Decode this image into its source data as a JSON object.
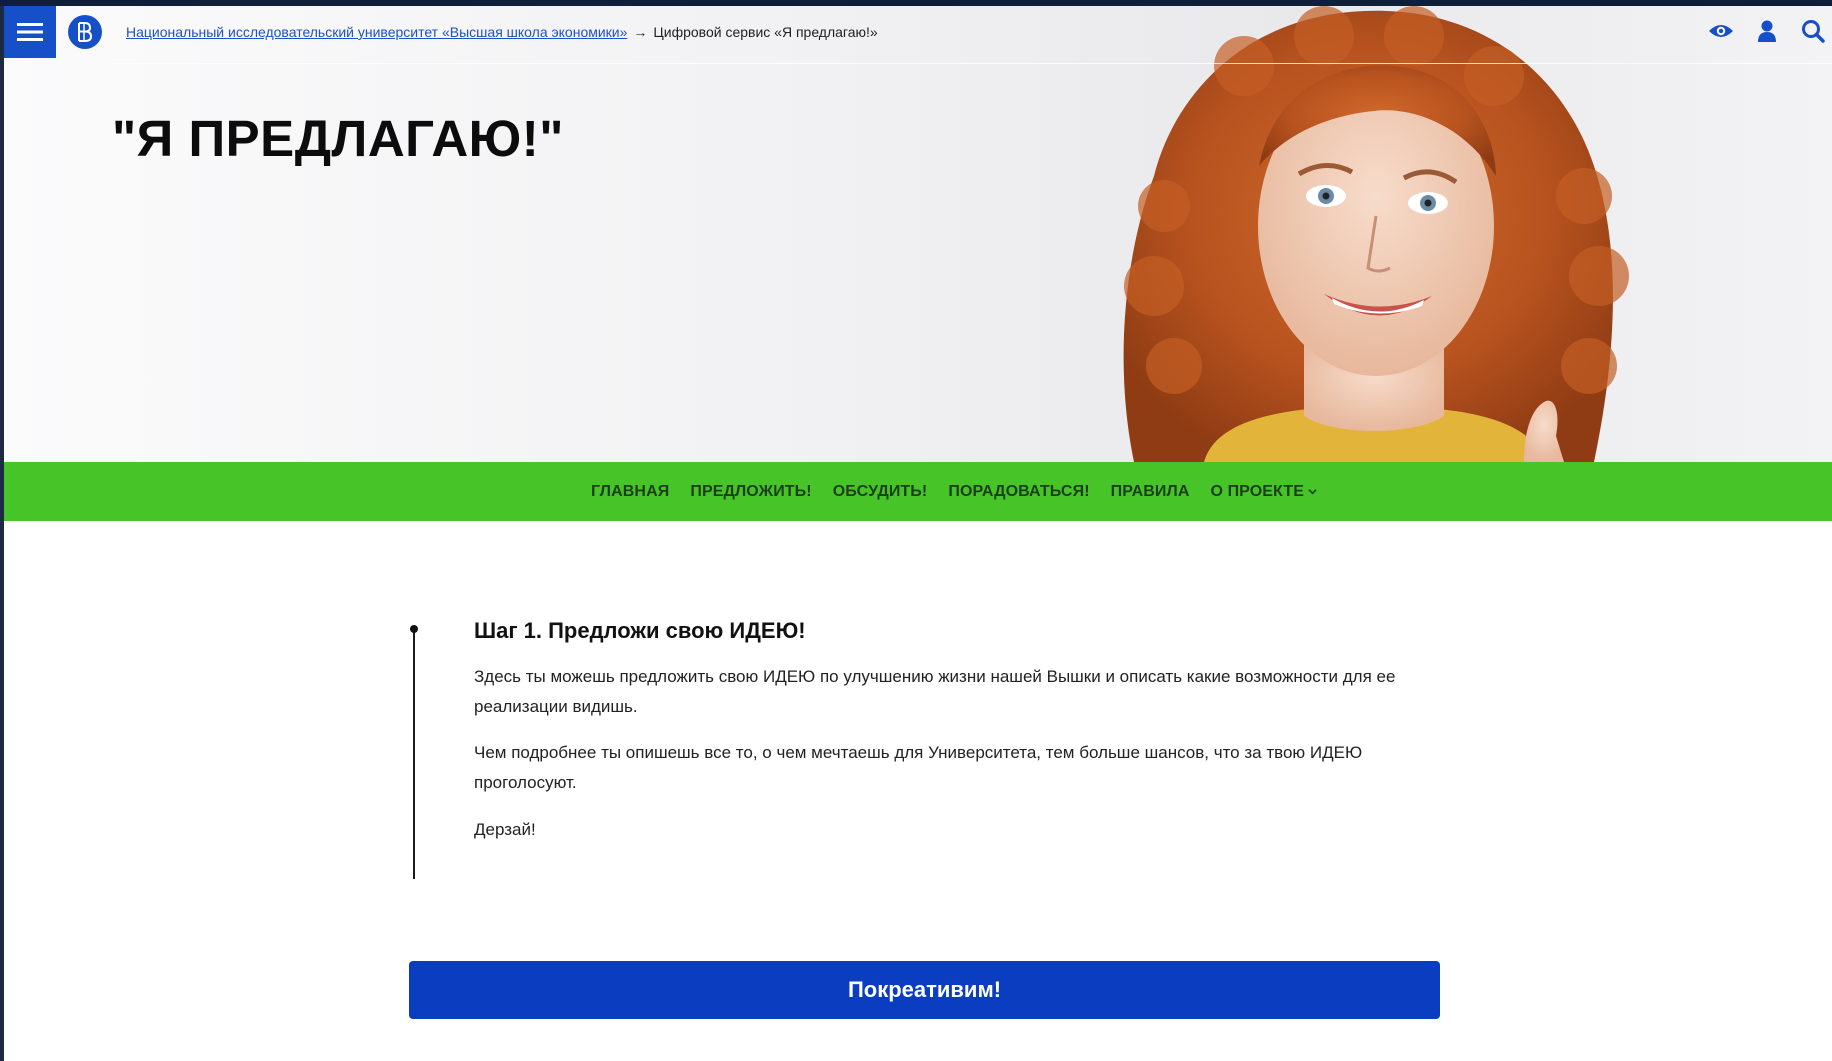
{
  "header": {
    "breadcrumb_parent": "Национальный исследовательский университет «Высшая школа экономики»",
    "breadcrumb_separator": "→",
    "breadcrumb_current": "Цифровой сервис «Я предлагаю!»",
    "icons": [
      "eye-icon",
      "user-icon",
      "search-icon"
    ]
  },
  "hero": {
    "title": "\"Я ПРЕДЛАГАЮ!\""
  },
  "nav": {
    "items": [
      {
        "label": "ГЛАВНАЯ"
      },
      {
        "label": "ПРЕДЛОЖИТЬ!"
      },
      {
        "label": "ОБСУДИТЬ!"
      },
      {
        "label": "ПОРАДОВАТЬСЯ!"
      },
      {
        "label": "ПРАВИЛА"
      },
      {
        "label": "О ПРОЕКТЕ"
      }
    ]
  },
  "step": {
    "title": "Шаг 1. Предложи свою ИДЕЮ!",
    "paragraph1": "Здесь ты можешь предложить свою ИДЕЮ по улучшению жизни нашей Вышки и описать какие возможности для ее реализации видишь.",
    "paragraph2": "Чем подробнее ты опишешь все то, о чем мечтаешь для Университета, тем больше шансов, что за твою ИДЕЮ проголосуют.",
    "paragraph3": "Дерзай!"
  },
  "cta": {
    "label": "Покреативим!"
  },
  "colors": {
    "brand_blue": "#1650c9",
    "button_blue": "#0a3dc0",
    "nav_green": "#46c428"
  }
}
